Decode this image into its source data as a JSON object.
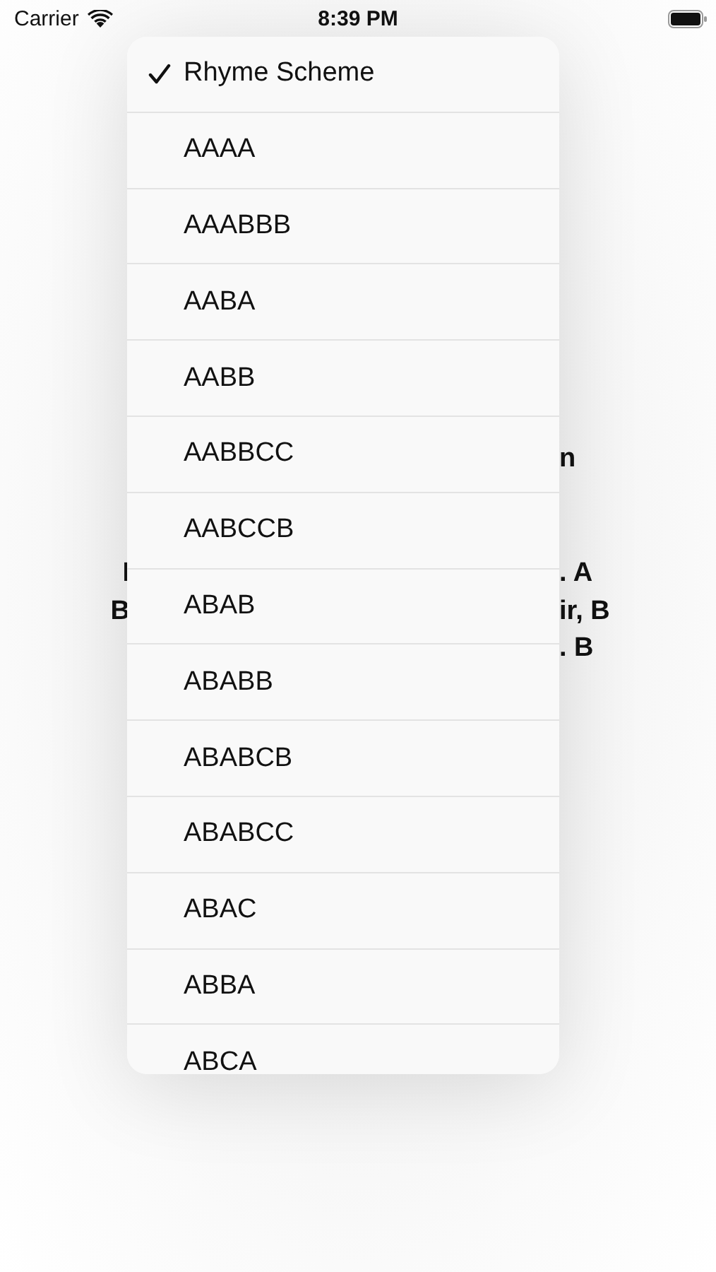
{
  "status_bar": {
    "carrier": "Carrier",
    "time": "8:39 PM"
  },
  "background_left": [
    "I",
    "B"
  ],
  "background_right": [
    "n",
    ". A",
    "ir, B",
    ". B"
  ],
  "menu": {
    "items": [
      {
        "label": "Rhyme Scheme",
        "selected": true
      },
      {
        "label": "AAAA",
        "selected": false
      },
      {
        "label": "AAABBB",
        "selected": false
      },
      {
        "label": "AABA",
        "selected": false
      },
      {
        "label": "AABB",
        "selected": false
      },
      {
        "label": "AABBCC",
        "selected": false
      },
      {
        "label": "AABCCB",
        "selected": false
      },
      {
        "label": "ABAB",
        "selected": false
      },
      {
        "label": "ABABB",
        "selected": false
      },
      {
        "label": "ABABCB",
        "selected": false
      },
      {
        "label": "ABABCC",
        "selected": false
      },
      {
        "label": "ABAC",
        "selected": false
      },
      {
        "label": "ABBA",
        "selected": false
      },
      {
        "label": "ABCA",
        "selected": false
      }
    ]
  }
}
